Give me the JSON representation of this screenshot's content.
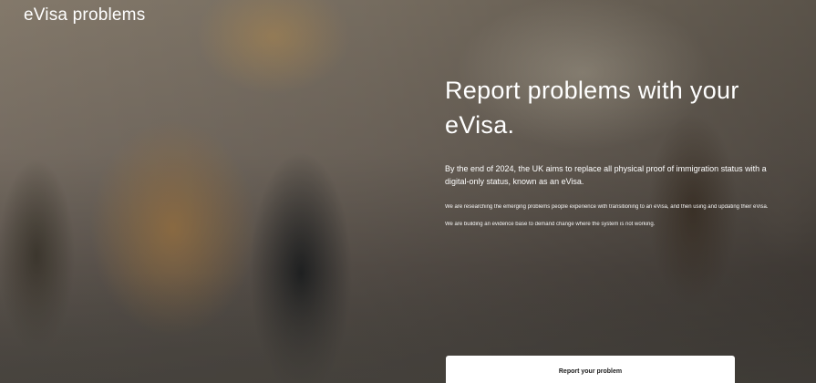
{
  "header": {
    "brand": "eVisa problems"
  },
  "hero": {
    "headline": "Report problems with your eVisa.",
    "lead": "By the end of 2024, the UK aims to replace all physical proof of immigration status with a digital-only status, known as an eVisa.",
    "paragraph_1": "We are researching the emerging problems people experience with transitioning to an eVisa, and then using and updating their eVisa.",
    "paragraph_2": "We are building an evidence base to demand change where the system is not working.",
    "cta_label": "Report your problem"
  }
}
